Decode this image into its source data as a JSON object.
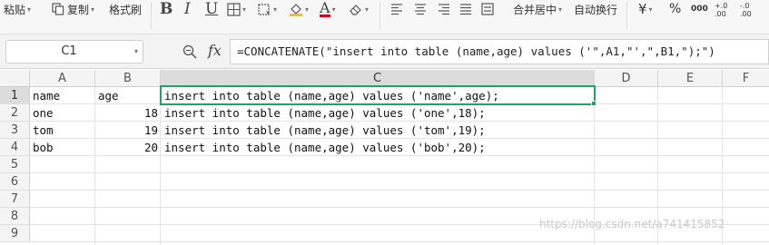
{
  "ribbon": {
    "paste": "粘贴",
    "copy": "复制",
    "format_painter": "格式刷",
    "bold": "B",
    "italic": "I",
    "underline": "U",
    "font_color_glyph": "A",
    "merge_center": "合并居中",
    "wrap_text": "自动换行",
    "currency": "¥",
    "percent": "%",
    "thousands": "000",
    "increase_decimal": "+.0\n.00",
    "decrease_decimal": "-.0\n.00",
    "accent_color": "#d0021b",
    "fill_color": "#f5c400"
  },
  "formula_bar": {
    "name_box": "C1",
    "fx": "fx",
    "formula": "=CONCATENATE(\"insert into table (name,age) values ('\",A1,\"',\",B1,\");\")"
  },
  "sheet": {
    "columns": [
      "A",
      "B",
      "C",
      "D",
      "E",
      "F"
    ],
    "rows": [
      "1",
      "2",
      "3",
      "4",
      "5",
      "6",
      "7",
      "8",
      "9"
    ],
    "cells": [
      {
        "a": "name",
        "b": "age",
        "c": "insert into table (name,age) values ('name',age);"
      },
      {
        "a": "one",
        "b": "18",
        "c": "insert into table (name,age) values ('one',18);"
      },
      {
        "a": "tom",
        "b": "19",
        "c": "insert into table (name,age) values ('tom',19);"
      },
      {
        "a": "bob",
        "b": "20",
        "c": "insert into table (name,age) values ('bob',20);"
      }
    ],
    "selection_color": "#21a366"
  },
  "watermark": "https://blog.csdn.net/a741415852"
}
